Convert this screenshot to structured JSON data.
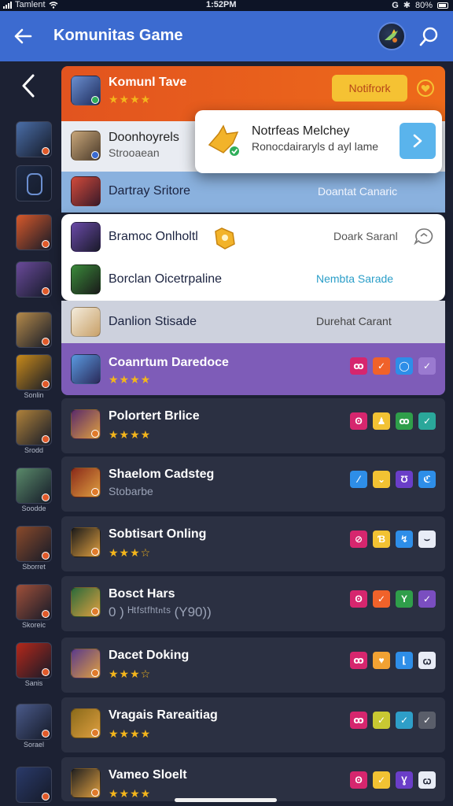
{
  "status_bar": {
    "carrier": "Tamlent",
    "time": "1:52PM",
    "battery": "80%"
  },
  "header": {
    "title": "Komunitas Game"
  },
  "rail": [
    {
      "label": "",
      "color": "#4a6ea8"
    },
    {
      "label": "",
      "color": "#1e2a44"
    },
    {
      "label": "",
      "color": "#d8592a"
    },
    {
      "label": "",
      "color": "#6a4a9a"
    },
    {
      "label": "",
      "color": "#b58a4a"
    },
    {
      "label": "Sonlin",
      "color": "#c98a1a"
    },
    {
      "label": "Srodd",
      "color": "#b0823a"
    },
    {
      "label": "Soodde",
      "color": "#5a8a6a"
    },
    {
      "label": "Sborret",
      "color": "#8a4a2a"
    },
    {
      "label": "Skoreic",
      "color": "#a0503a"
    },
    {
      "label": "Sanis",
      "color": "#b5281a"
    },
    {
      "label": "Sorael",
      "color": "#4a5a8a"
    },
    {
      "label": "",
      "color": "#2a3a6a"
    }
  ],
  "top_card": {
    "name": "Komunl Tave",
    "stars": "★★★★",
    "notify_label": "Notifrork"
  },
  "popup": {
    "title": "Notrfeas Melchey",
    "subtitle": "Ronocdairaryls d ayl lame"
  },
  "rows_light": [
    {
      "name": "Doonhoyrels",
      "sub": "Strooaean",
      "right": ""
    },
    {
      "name": "Dartray Sritore",
      "sub": "",
      "right": "Doantat Canaric"
    },
    {
      "name": "Bramoc Onlholtl",
      "sub": "",
      "right": "Doark Saranl"
    },
    {
      "name": "Borclan Oicetrpaline",
      "sub": "",
      "right": "Nembta Sarade"
    },
    {
      "name": "Danlion Stisade",
      "sub": "",
      "right": "Durehat Carant"
    }
  ],
  "purple_card": {
    "name": "Coanrtum Daredoce",
    "stars": "★★★★"
  },
  "rows_dark": [
    {
      "name": "Polortert Brlice",
      "sub": "",
      "stars": "★★★★",
      "actions": [
        [
          "ʘ",
          "#d6266e"
        ],
        [
          "♟",
          "#f2c233"
        ],
        [
          "ꝏ",
          "#2f9e4a"
        ],
        [
          "✓",
          "#2aa79a"
        ]
      ]
    },
    {
      "name": "Shaelom Cadsteg",
      "sub": "Stobarbe",
      "stars": "",
      "actions": [
        [
          "⁄",
          "#2e8ee8"
        ],
        [
          "⌄",
          "#f2c233"
        ],
        [
          "Ʊ",
          "#6a3ec8"
        ],
        [
          "ℭ",
          "#2e8ee8"
        ]
      ]
    },
    {
      "name": "Sobtisart Onling",
      "sub": "",
      "stars": "★★★☆",
      "actions": [
        [
          "⊘",
          "#d6266e"
        ],
        [
          "Ɓ",
          "#f2c233"
        ],
        [
          "↯",
          "#2e8ee8"
        ],
        [
          "⌣",
          "#e8ecf6"
        ]
      ]
    },
    {
      "name": "Bosct Hars",
      "sub": "0 ) ᴴᵗᶠˢᵗᶠʰᵗⁿᵗˢ (Y90))",
      "stars": "",
      "actions": [
        [
          "ʘ",
          "#d6266e"
        ],
        [
          "✓",
          "#f0622a"
        ],
        [
          "Y",
          "#2f9e4a"
        ],
        [
          "✓",
          "#7a4ec0"
        ]
      ]
    },
    {
      "name": "Dacet Doking",
      "sub": "",
      "stars": "★★★☆",
      "actions": [
        [
          "ꝏ",
          "#d6266e"
        ],
        [
          "♥",
          "#f2a233"
        ],
        [
          "⌊",
          "#2e8ee8"
        ],
        [
          "ꞷ",
          "#e8ecf6"
        ]
      ]
    },
    {
      "name": "Vragais Rareaitiag",
      "sub": "",
      "stars": "★★★★",
      "actions": [
        [
          "ꝏ",
          "#d6266e"
        ],
        [
          "✓",
          "#c8c832"
        ],
        [
          "✓",
          "#2e9ec8"
        ],
        [
          "✓",
          "#5a5e6a"
        ]
      ]
    },
    {
      "name": "Vameo Sloelt",
      "sub": "",
      "stars": "★★★★",
      "actions": [
        [
          "ʘ",
          "#d6266e"
        ],
        [
          "✓",
          "#f2c233"
        ],
        [
          "Ɣ",
          "#6a3ec8"
        ],
        [
          "ꞷ",
          "#e8ecf6"
        ]
      ]
    }
  ],
  "colors": {
    "header": "#3c6bd0",
    "background": "#1c2133",
    "accent_orange": "#e2541f",
    "star": "#f3b51c"
  }
}
